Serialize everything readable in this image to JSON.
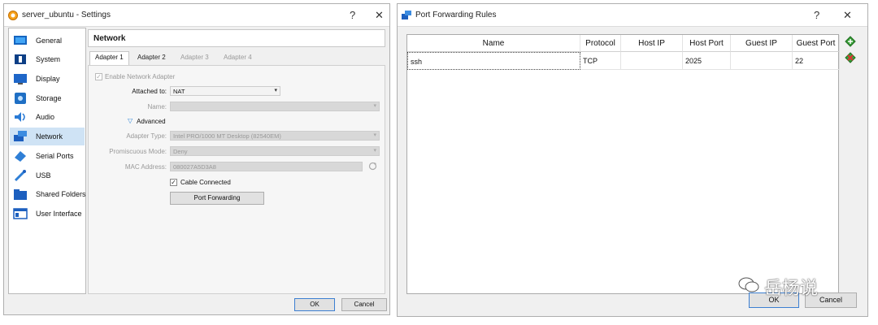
{
  "settings": {
    "title": "server_ubuntu - Settings",
    "help": "?",
    "close": "✕",
    "sidebar": {
      "items": [
        {
          "label": "General",
          "icon": "general-icon"
        },
        {
          "label": "System",
          "icon": "system-icon"
        },
        {
          "label": "Display",
          "icon": "display-icon"
        },
        {
          "label": "Storage",
          "icon": "storage-icon"
        },
        {
          "label": "Audio",
          "icon": "audio-icon"
        },
        {
          "label": "Network",
          "icon": "network-icon"
        },
        {
          "label": "Serial Ports",
          "icon": "serial-ports-icon"
        },
        {
          "label": "USB",
          "icon": "usb-icon"
        },
        {
          "label": "Shared Folders",
          "icon": "shared-folders-icon"
        },
        {
          "label": "User Interface",
          "icon": "user-interface-icon"
        }
      ],
      "active": "Network"
    },
    "section_title": "Network",
    "tabs": [
      "Adapter 1",
      "Adapter 2",
      "Adapter 3",
      "Adapter 4"
    ],
    "enable_adapter": "Enable Network Adapter",
    "attached_to_label": "Attached to:",
    "attached_to_value": "NAT",
    "name_label": "Name:",
    "advanced_label": "Advanced",
    "adapter_type_label": "Adapter Type:",
    "adapter_type_value": "Intel PRO/1000 MT Desktop (82540EM)",
    "promiscuous_label": "Promiscuous Mode:",
    "promiscuous_value": "Deny",
    "mac_label": "MAC Address:",
    "mac_value": "080027A5D3A8",
    "cable_connected": "Cable Connected",
    "port_forwarding_button": "Port Forwarding",
    "ok": "OK",
    "cancel": "Cancel"
  },
  "port_forwarding": {
    "title": "Port Forwarding Rules",
    "help": "?",
    "close": "✕",
    "columns": [
      "Name",
      "Protocol",
      "Host IP",
      "Host Port",
      "Guest IP",
      "Guest Port"
    ],
    "rows": [
      {
        "name": "ssh",
        "protocol": "TCP",
        "host_ip": "",
        "host_port": "2025",
        "guest_ip": "",
        "guest_port": "22"
      }
    ],
    "ok": "OK",
    "cancel": "Cancel"
  },
  "watermark": "岳杨说",
  "colors": {
    "accent": "#3c7fd1",
    "selection": "#cfe3f5",
    "window_bg": "#f0f0f0"
  }
}
